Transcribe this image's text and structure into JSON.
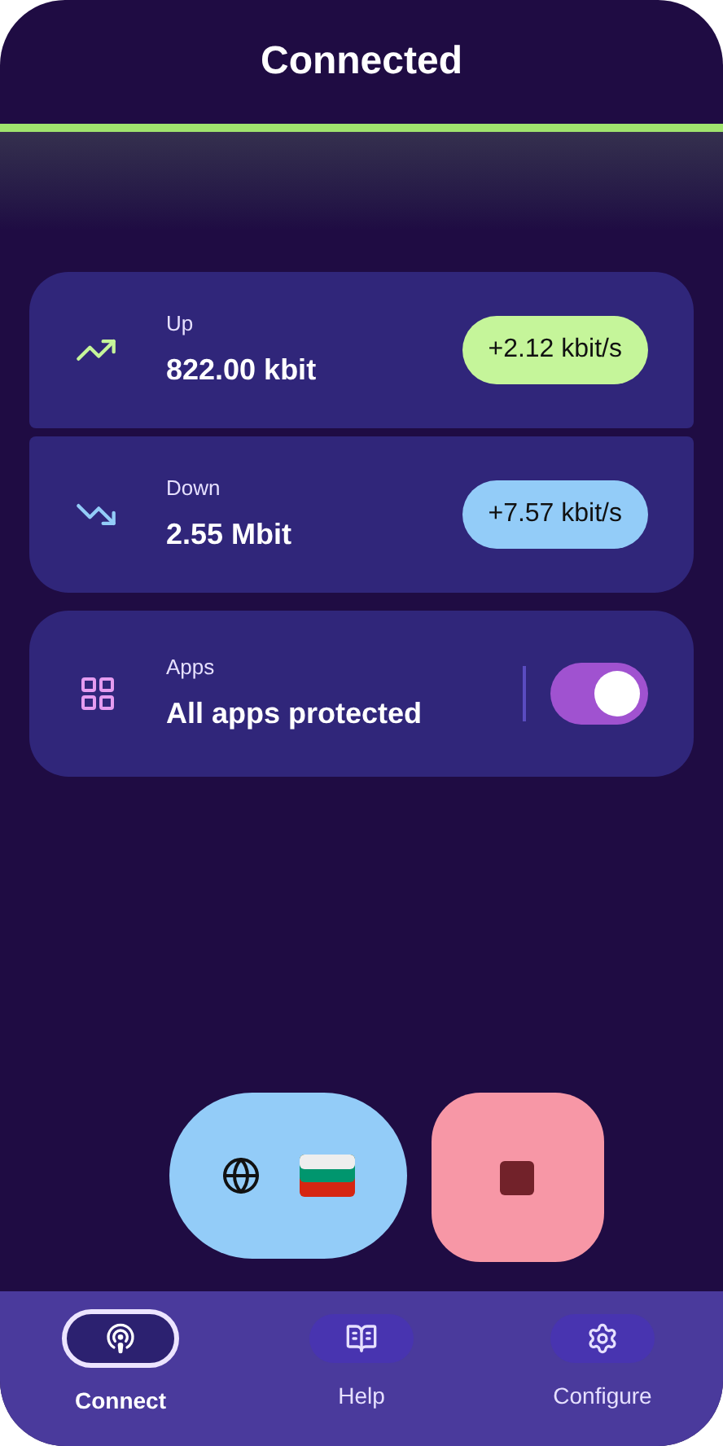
{
  "title": "Connected",
  "connected": true,
  "stats": [
    {
      "kind": "up",
      "label": "Up",
      "value": "822.00 kbit",
      "rate": "+2.12 kbit/s",
      "color": "#c5f59a"
    },
    {
      "kind": "down",
      "label": "Down",
      "value": "2.55 Mbit",
      "rate": "+7.57 kbit/s",
      "color": "#93ccf8"
    }
  ],
  "apps": {
    "label": "Apps",
    "value": "All apps protected",
    "on": true
  },
  "nav": [
    {
      "kind": "connect",
      "label": "Connect",
      "selected": true
    },
    {
      "kind": "help",
      "label": "Help",
      "selected": false
    },
    {
      "kind": "configure",
      "label": "Configure",
      "selected": false
    }
  ]
}
